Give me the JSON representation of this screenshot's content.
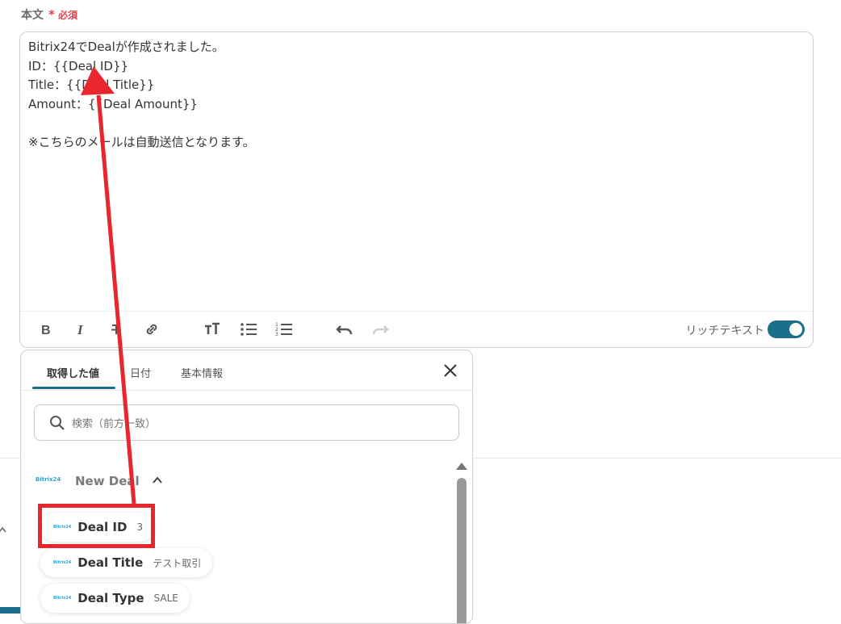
{
  "field": {
    "label": "本文",
    "required_mark": "*",
    "required_text": "必須"
  },
  "editor": {
    "lines": [
      "Bitrix24でDealが作成されました。",
      "ID：{{Deal ID}}",
      "Title：{{Deal Title}}",
      "Amount：{{Deal Amount}}",
      "",
      "※こちらのメールは自動送信となります。"
    ]
  },
  "toolbar": {
    "buttons": [
      "bold-icon",
      "italic-icon",
      "strikethrough-icon",
      "link-icon",
      "text-size-icon",
      "bullet-list-icon",
      "numbered-list-icon",
      "undo-icon",
      "redo-icon"
    ],
    "rich_text_label": "リッチテキスト",
    "rich_text_enabled": true
  },
  "popup": {
    "tabs": [
      {
        "label": "取得した値",
        "active": true
      },
      {
        "label": "日付",
        "active": false
      },
      {
        "label": "基本情報",
        "active": false
      }
    ],
    "search_placeholder": "検索（前方一致）",
    "group": {
      "logo_text": "Bitrix24",
      "title": "New Deal",
      "expanded": true
    },
    "items": [
      {
        "logo_text": "Bitrix24",
        "name": "Deal ID",
        "value": "3"
      },
      {
        "logo_text": "Bitrix24",
        "name": "Deal Title",
        "value": "テスト取引"
      },
      {
        "logo_text": "Bitrix24",
        "name": "Deal Type",
        "value": "SALE"
      }
    ]
  },
  "colors": {
    "accent": "#1b6e8a",
    "required": "#e0424b",
    "annotation": "#e8262d"
  }
}
